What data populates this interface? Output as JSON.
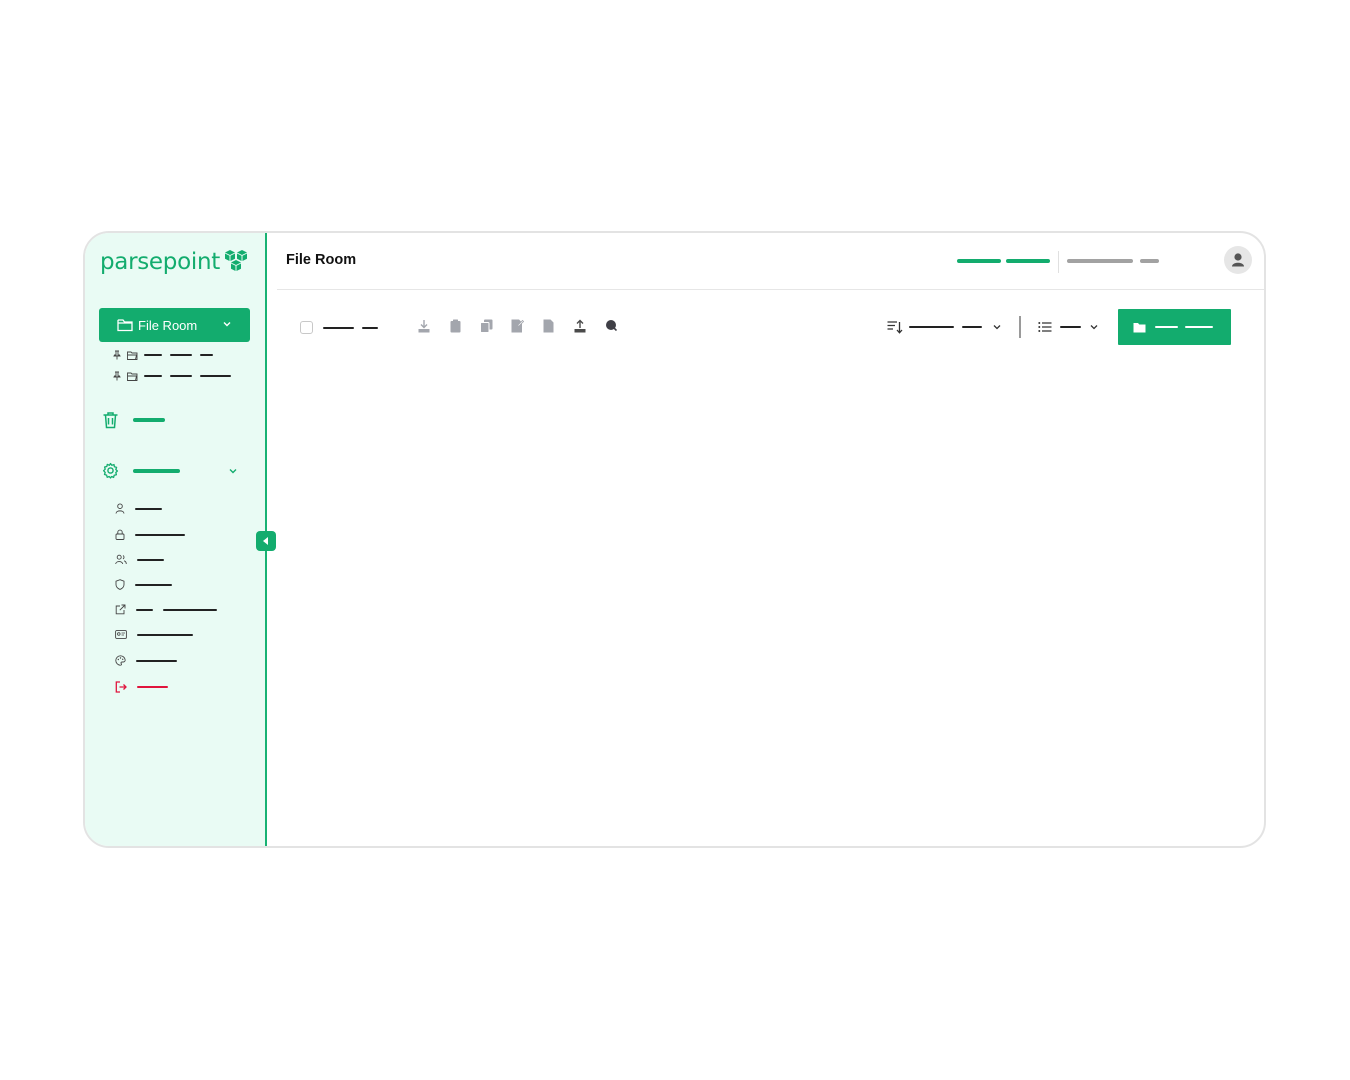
{
  "header": {
    "title": "File Room"
  },
  "sidebar": {
    "logo_text": "parsepoint",
    "primary_button": {
      "label": "File Room"
    }
  },
  "colors": {
    "brand": "#13ac6e",
    "sidebar_bg": "#e9fbf4",
    "danger": "#e0143c",
    "text_dark": "#222222",
    "icon_grey": "#a3a6ad"
  },
  "icons": {
    "logo": "cube-cluster-icon",
    "primary_button": "folder-icon",
    "trash": "trash-icon",
    "settings": "gear-icon",
    "settings_items": [
      "user-icon",
      "lock-icon",
      "users-icon",
      "shield-icon",
      "external-link-icon",
      "id-card-icon",
      "palette-icon",
      "logout-icon"
    ],
    "toolbar": [
      "download-icon",
      "clipboard-icon",
      "copy-icon",
      "file-edit-icon",
      "file-icon",
      "upload-icon",
      "tag-icon"
    ],
    "sort": "sort-icon",
    "view": "list-view-icon",
    "new": "folder-icon"
  }
}
